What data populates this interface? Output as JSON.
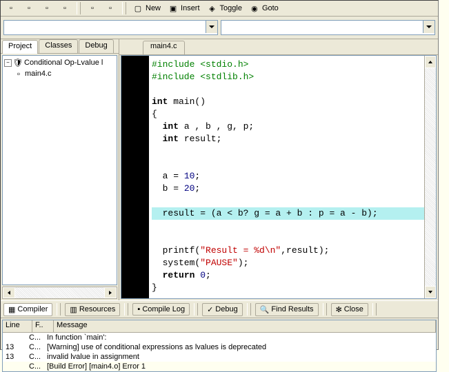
{
  "toolbar": {
    "buttons": [
      {
        "name": "win-tile-icon"
      },
      {
        "name": "win-cascade-icon"
      },
      {
        "name": "win-max-icon"
      },
      {
        "name": "win-list-icon"
      },
      {
        "sep": true
      },
      {
        "name": "help-icon"
      },
      {
        "name": "about-icon"
      },
      {
        "sep": true
      },
      {
        "name": "new-btn",
        "label": "New",
        "icon": "▢"
      },
      {
        "name": "insert-btn",
        "label": "Insert",
        "icon": "▣"
      },
      {
        "name": "toggle-btn",
        "label": "Toggle",
        "icon": "◈"
      },
      {
        "name": "goto-btn",
        "label": "Goto",
        "icon": "◉"
      }
    ]
  },
  "combos": {
    "left": "",
    "right": ""
  },
  "side_tabs": [
    "Project",
    "Classes",
    "Debug"
  ],
  "tree": {
    "root_label": "Conditional Op-Lvalue l",
    "child_label": "main4.c"
  },
  "file_tab": "main4.c",
  "code_lines": [
    {
      "seg": [
        {
          "t": "#include <stdio.h>",
          "c": "pp"
        }
      ]
    },
    {
      "seg": [
        {
          "t": "#include <stdlib.h>",
          "c": "pp"
        }
      ]
    },
    {
      "seg": [
        {
          "t": "",
          "c": ""
        }
      ]
    },
    {
      "seg": [
        {
          "t": "int",
          "c": "kw"
        },
        {
          "t": " main()",
          "c": ""
        }
      ]
    },
    {
      "seg": [
        {
          "t": "{",
          "c": ""
        }
      ]
    },
    {
      "seg": [
        {
          "t": "  ",
          "c": ""
        },
        {
          "t": "int",
          "c": "kw"
        },
        {
          "t": " a , b , g, p;",
          "c": ""
        }
      ]
    },
    {
      "seg": [
        {
          "t": "  ",
          "c": ""
        },
        {
          "t": "int",
          "c": "kw"
        },
        {
          "t": " result;",
          "c": ""
        }
      ]
    },
    {
      "seg": [
        {
          "t": "",
          "c": ""
        }
      ]
    },
    {
      "seg": [
        {
          "t": "",
          "c": ""
        }
      ]
    },
    {
      "seg": [
        {
          "t": "  a = ",
          "c": ""
        },
        {
          "t": "10",
          "c": "cconst"
        },
        {
          "t": ";",
          "c": ""
        }
      ]
    },
    {
      "seg": [
        {
          "t": "  b = ",
          "c": ""
        },
        {
          "t": "20",
          "c": "cconst"
        },
        {
          "t": ";",
          "c": ""
        }
      ]
    },
    {
      "seg": [
        {
          "t": "",
          "c": ""
        }
      ]
    },
    {
      "hl": true,
      "seg": [
        {
          "t": "  result = (a < b? g = a + b : p = a - b);",
          "c": ""
        }
      ]
    },
    {
      "seg": [
        {
          "t": "",
          "c": ""
        }
      ]
    },
    {
      "seg": [
        {
          "t": "  printf(",
          "c": ""
        },
        {
          "t": "\"Result = %d\\n\"",
          "c": "cstr"
        },
        {
          "t": ",result);",
          "c": ""
        }
      ]
    },
    {
      "seg": [
        {
          "t": "  system(",
          "c": ""
        },
        {
          "t": "\"PAUSE\"",
          "c": "cstr"
        },
        {
          "t": ");",
          "c": ""
        }
      ]
    },
    {
      "seg": [
        {
          "t": "  ",
          "c": ""
        },
        {
          "t": "return",
          "c": "kw"
        },
        {
          "t": " ",
          "c": ""
        },
        {
          "t": "0",
          "c": "cconst"
        },
        {
          "t": ";",
          "c": ""
        }
      ]
    },
    {
      "seg": [
        {
          "t": "}",
          "c": ""
        }
      ]
    }
  ],
  "bottom_tabs": [
    {
      "label": "Compiler",
      "icon": "▦",
      "active": true
    },
    {
      "label": "Resources",
      "icon": "▥"
    },
    {
      "label": "Compile Log",
      "icon": "▪"
    },
    {
      "label": "Debug",
      "icon": "✓"
    },
    {
      "label": "Find Results",
      "icon": "🔍"
    },
    {
      "label": "Close",
      "icon": "✻"
    }
  ],
  "msg_cols": {
    "line": "Line",
    "file": "F..",
    "message": "Message"
  },
  "msg_rows": [
    {
      "line": "",
      "file": "C...",
      "msg": "In function `main':"
    },
    {
      "line": "13",
      "file": "C...",
      "msg": "[Warning] use of conditional expressions as lvalues is deprecated"
    },
    {
      "line": "13",
      "file": "C...",
      "msg": "invalid lvalue in assignment"
    },
    {
      "line": "",
      "file": "C...",
      "msg": "[Build Error]  [main4.o] Error 1"
    }
  ]
}
